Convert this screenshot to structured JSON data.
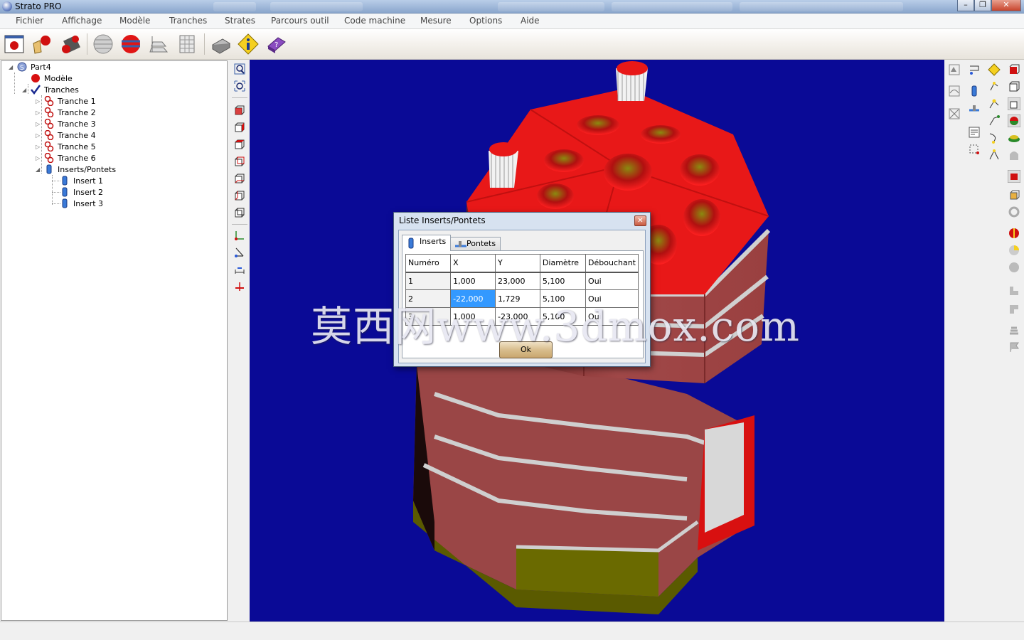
{
  "window": {
    "title": "Strato PRO"
  },
  "menu": [
    "Fichier",
    "Affichage",
    "Modèle",
    "Tranches",
    "Strates",
    "Parcours outil",
    "Code machine",
    "Mesure",
    "Options",
    "Aide"
  ],
  "tree": {
    "root": "Part4",
    "model": "Modèle",
    "slices_group": "Tranches",
    "slices": [
      "Tranche 1",
      "Tranche 2",
      "Tranche 3",
      "Tranche 4",
      "Tranche 5",
      "Tranche 6"
    ],
    "inserts_group": "Inserts/Pontets",
    "inserts": [
      "Insert 1",
      "Insert 2",
      "Insert 3"
    ]
  },
  "dialog": {
    "title": "Liste Inserts/Pontets",
    "tabs": [
      "Inserts",
      "Pontets"
    ],
    "columns": [
      "Numéro",
      "X",
      "Y",
      "Diamètre",
      "Débouchant"
    ],
    "rows": [
      [
        "1",
        "1,000",
        "23,000",
        "5,100",
        "Oui"
      ],
      [
        "2",
        "-22,000",
        "1,729",
        "5,100",
        "Oui"
      ],
      [
        "3",
        "1,000",
        "-23,000",
        "5,100",
        "Oui"
      ]
    ],
    "ok_label": "Ok"
  },
  "watermark": "莫西网www.3dmox.com",
  "colors": {
    "viewport_bg": "#0a0a96",
    "model_red": "#e01010",
    "selection": "#3399ff"
  }
}
